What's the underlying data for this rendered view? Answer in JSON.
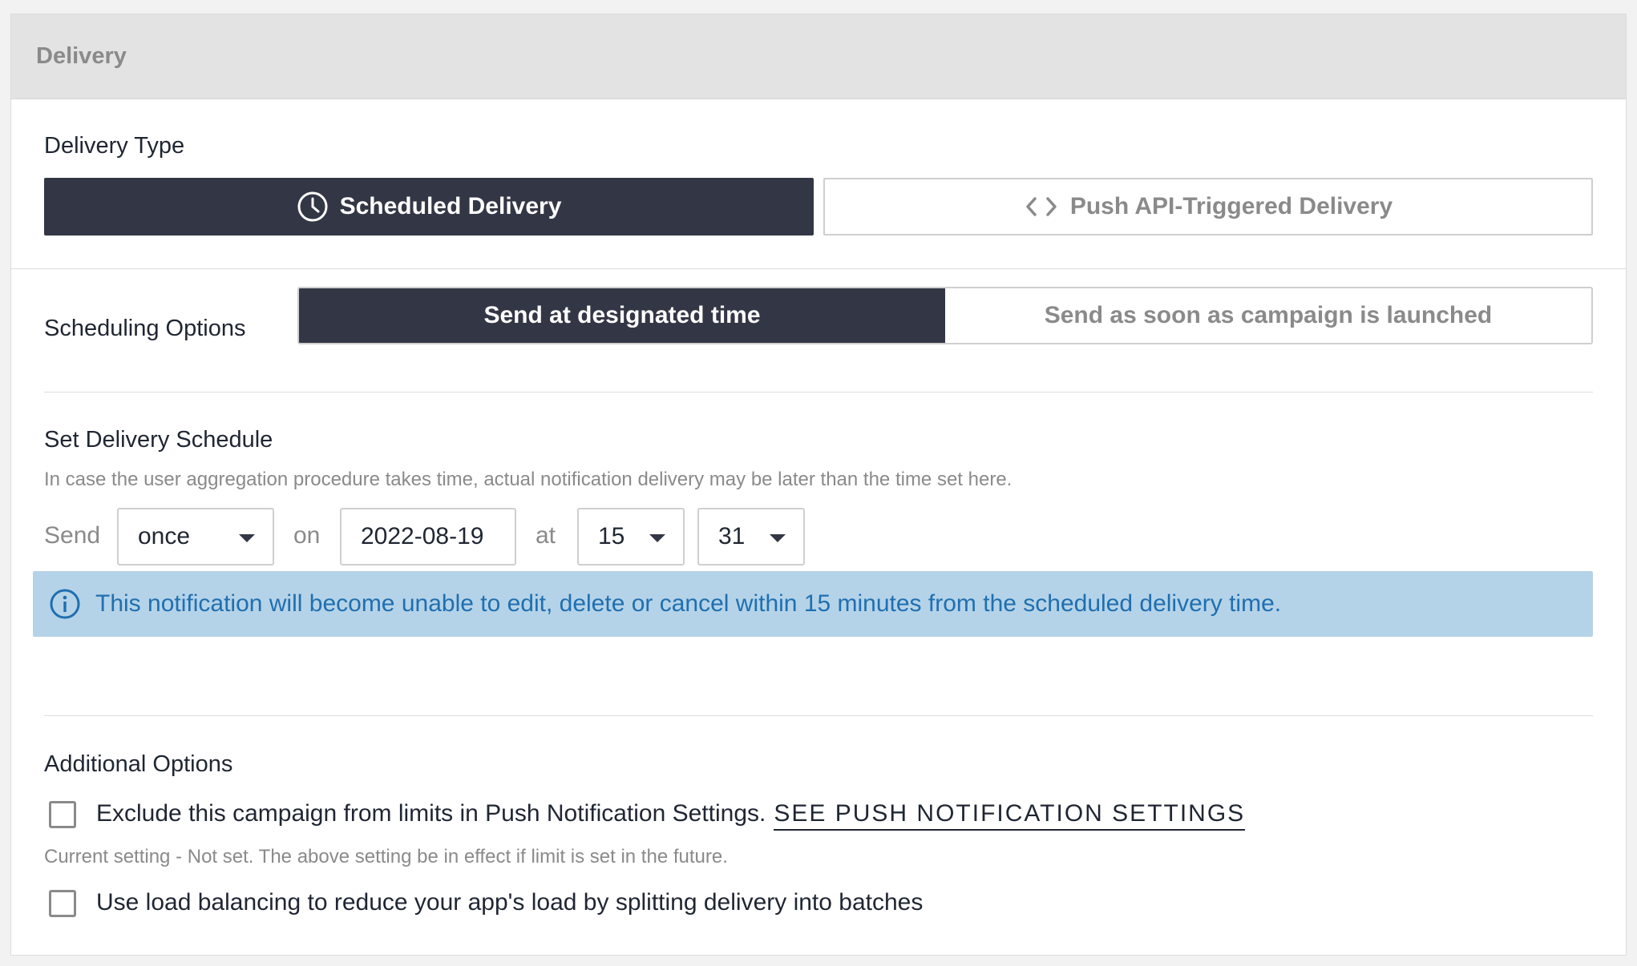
{
  "panel": {
    "title": "Delivery"
  },
  "delivery_type": {
    "heading": "Delivery Type",
    "scheduled_label": "Scheduled Delivery",
    "api_label": "Push API-Triggered Delivery",
    "selected": "scheduled"
  },
  "scheduling": {
    "heading": "Scheduling Options",
    "designated_label": "Send at designated time",
    "immediate_label": "Send as soon as campaign is launched",
    "selected": "designated"
  },
  "schedule": {
    "heading": "Set Delivery Schedule",
    "hint": "In case the user aggregation procedure takes time, actual notification delivery may be later than the time set here.",
    "send_label": "Send",
    "frequency_value": "once",
    "on_label": "on",
    "date_value": "2022-08-19",
    "at_label": "at",
    "hour_value": "15",
    "minute_value": "31"
  },
  "info": {
    "message": "This notification will become unable to edit, delete or cancel within 15 minutes from the scheduled delivery time.",
    "icon": "info-icon",
    "color": "#1f6fb0",
    "background": "#b5d3e8"
  },
  "additional": {
    "heading": "Additional Options",
    "exclude_label": "Exclude this campaign from limits in Push Notification Settings.",
    "exclude_link": "SEE PUSH NOTIFICATION SETTINGS",
    "exclude_checked": false,
    "current_setting": "Current setting - Not set. The above setting be in effect if limit is set in the future.",
    "balance_label": "Use load balancing to reduce your app's load by splitting delivery into batches",
    "balance_checked": false
  },
  "colors": {
    "active_bg": "#333745",
    "header_bg": "#e3e3e3"
  }
}
